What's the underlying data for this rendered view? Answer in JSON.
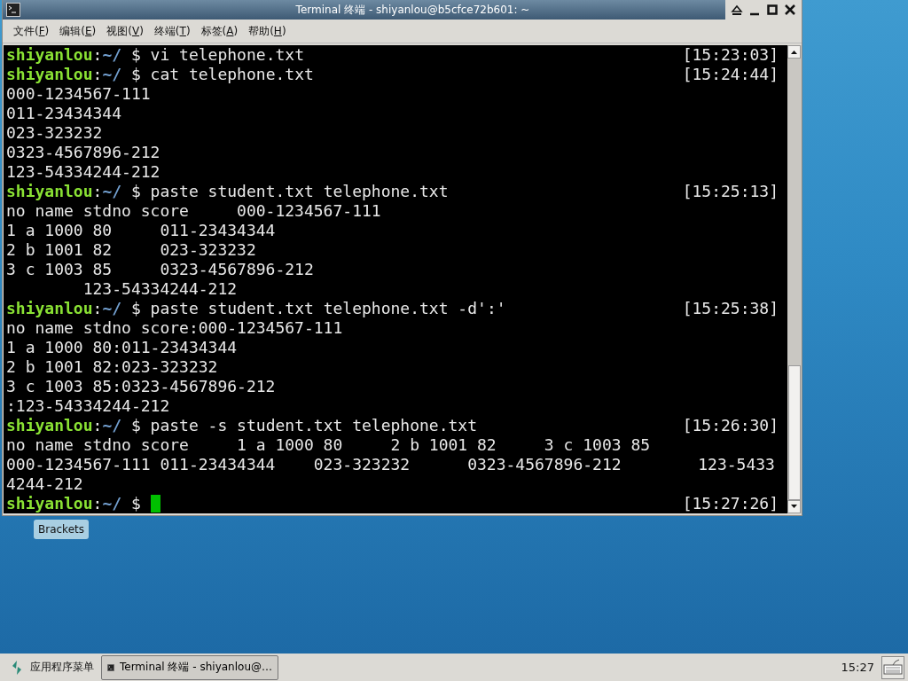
{
  "window": {
    "title": "Terminal 终端 - shiyanlou@b5cfce72b601: ~"
  },
  "menu": [
    {
      "before": "文件(",
      "mnemonic": "F",
      "after": ")"
    },
    {
      "before": "编辑(",
      "mnemonic": "E",
      "after": ")"
    },
    {
      "before": "视图(",
      "mnemonic": "V",
      "after": ")"
    },
    {
      "before": "终端(",
      "mnemonic": "T",
      "after": ")"
    },
    {
      "before": "标签(",
      "mnemonic": "A",
      "after": ")"
    },
    {
      "before": "帮助(",
      "mnemonic": "H",
      "after": ")"
    }
  ],
  "terminal": {
    "lines": [
      {
        "kind": "prompt",
        "user": "shiyanlou",
        "sep": ":",
        "path": "~/",
        "symbol": "$",
        "command": "vi telephone.txt",
        "time": "[15:23:03]",
        "cursor": false
      },
      {
        "kind": "prompt",
        "user": "shiyanlou",
        "sep": ":",
        "path": "~/",
        "symbol": "$",
        "command": "cat telephone.txt",
        "time": "[15:24:44]",
        "cursor": false
      },
      {
        "kind": "output",
        "text": "000-1234567-111"
      },
      {
        "kind": "output",
        "text": "011-23434344"
      },
      {
        "kind": "output",
        "text": "023-323232"
      },
      {
        "kind": "output",
        "text": "0323-4567896-212"
      },
      {
        "kind": "output",
        "text": "123-54334244-212"
      },
      {
        "kind": "prompt",
        "user": "shiyanlou",
        "sep": ":",
        "path": "~/",
        "symbol": "$",
        "command": "paste student.txt telephone.txt",
        "time": "[15:25:13]",
        "cursor": false
      },
      {
        "kind": "output",
        "text": "no name stdno score     000-1234567-111"
      },
      {
        "kind": "output",
        "text": "1 a 1000 80     011-23434344"
      },
      {
        "kind": "output",
        "text": "2 b 1001 82     023-323232"
      },
      {
        "kind": "output",
        "text": "3 c 1003 85     0323-4567896-212"
      },
      {
        "kind": "output",
        "text": "        123-54334244-212"
      },
      {
        "kind": "prompt",
        "user": "shiyanlou",
        "sep": ":",
        "path": "~/",
        "symbol": "$",
        "command": "paste student.txt telephone.txt -d':'",
        "time": "[15:25:38]",
        "cursor": false
      },
      {
        "kind": "output",
        "text": "no name stdno score:000-1234567-111"
      },
      {
        "kind": "output",
        "text": "1 a 1000 80:011-23434344"
      },
      {
        "kind": "output",
        "text": "2 b 1001 82:023-323232"
      },
      {
        "kind": "output",
        "text": "3 c 1003 85:0323-4567896-212"
      },
      {
        "kind": "output",
        "text": ":123-54334244-212"
      },
      {
        "kind": "prompt",
        "user": "shiyanlou",
        "sep": ":",
        "path": "~/",
        "symbol": "$",
        "command": "paste -s student.txt telephone.txt",
        "time": "[15:26:30]",
        "cursor": false
      },
      {
        "kind": "output",
        "text": "no name stdno score     1 a 1000 80     2 b 1001 82     3 c 1003 85"
      },
      {
        "kind": "output",
        "text": "000-1234567-111 011-23434344    023-323232      0323-4567896-212        123-5433"
      },
      {
        "kind": "output",
        "text": "4244-212"
      },
      {
        "kind": "prompt",
        "user": "shiyanlou",
        "sep": ":",
        "path": "~/",
        "symbol": "$",
        "time": "[15:27:26]",
        "cursor": true
      }
    ]
  },
  "desktop": {
    "icons": [
      {
        "label": "Brackets"
      }
    ]
  },
  "taskbar": {
    "start_menu": "应用程序菜单",
    "tasks": [
      {
        "label": "Terminal 终端 - shiyanlou@…",
        "selected": true
      }
    ],
    "clock": "15:27"
  }
}
